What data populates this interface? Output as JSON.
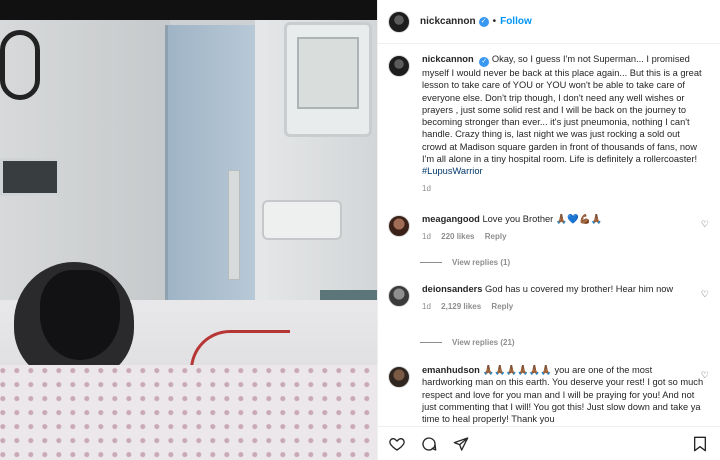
{
  "post": {
    "username": "nickcannon",
    "follow_label": "Follow",
    "separator": "•",
    "caption": "Okay, so I guess I'm not Superman... I promised myself I would never be back at this place again... But this is a great lesson to take care of YOU or YOU won't be able to take care of everyone else. Don't trip though, I don't need any well wishes or prayers , just some solid rest and I will be back on the journey to becoming stronger than ever... it's just pneumonia, nothing I can't handle. Crazy thing is, last night we was just rocking a sold out crowd at Madison square garden in front of thousands of fans, now I'm all alone in a tiny hospital room. Life is definitely a rollercoaster!",
    "hashtag": "#LupusWarrior",
    "time": "1d"
  },
  "comments": [
    {
      "username": "meagangood",
      "text": "Love you Brother 🙏🏾💙💪🏾🙏🏾",
      "time": "1d",
      "likes": "220 likes",
      "reply_label": "Reply",
      "view_replies": "View replies (1)"
    },
    {
      "username": "deionsanders",
      "text": "God has u covered my brother! Hear him now",
      "time": "1d",
      "likes": "2,129 likes",
      "reply_label": "Reply",
      "view_replies": "View replies (21)"
    },
    {
      "username": "emanhudson",
      "text": "🙏🏾🙏🏾🙏🏾🙏🏾🙏🏾🙏🏾 you are one of the most hardworking man on this earth. You deserve your rest! I got so much respect and love for you man and I will be praying for you! And not just commenting that I will! You got this! Just slow down and take ya time to heal properly! Thank you"
    }
  ],
  "icons": {
    "heart": "heart-icon",
    "comment": "comment-icon",
    "share": "share-icon",
    "bookmark": "bookmark-icon",
    "verified": "verified-badge-icon"
  },
  "colors": {
    "link_blue": "#0095f6",
    "verified_blue": "#3897f0",
    "hashtag": "#00376b",
    "muted": "#8e8e8e"
  }
}
